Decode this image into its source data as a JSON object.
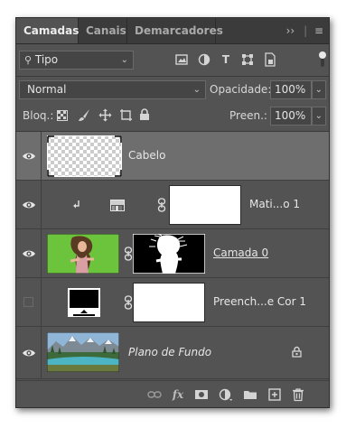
{
  "tabs": [
    "Camadas",
    "Canais",
    "Demarcadores"
  ],
  "filter": {
    "kind_label": "Tipo"
  },
  "blend": {
    "mode": "Normal",
    "opacity_label": "Opacidade:",
    "opacity_value": "100%"
  },
  "lock": {
    "label": "Bloq.:",
    "fill_label": "Preen.:",
    "fill_value": "100%"
  },
  "layers": [
    {
      "name": "Cabelo",
      "visible": true
    },
    {
      "name": "Mati...o 1",
      "visible": true
    },
    {
      "name": "Camada 0",
      "visible": true
    },
    {
      "name": "Preench...e Cor 1",
      "visible": false
    },
    {
      "name": "Plano de Fundo",
      "visible": true
    }
  ],
  "colors": {
    "panel": "#535353",
    "selected": "#6e6e6e",
    "tabbar": "#3b3b3b",
    "green": "#6cc33c"
  }
}
